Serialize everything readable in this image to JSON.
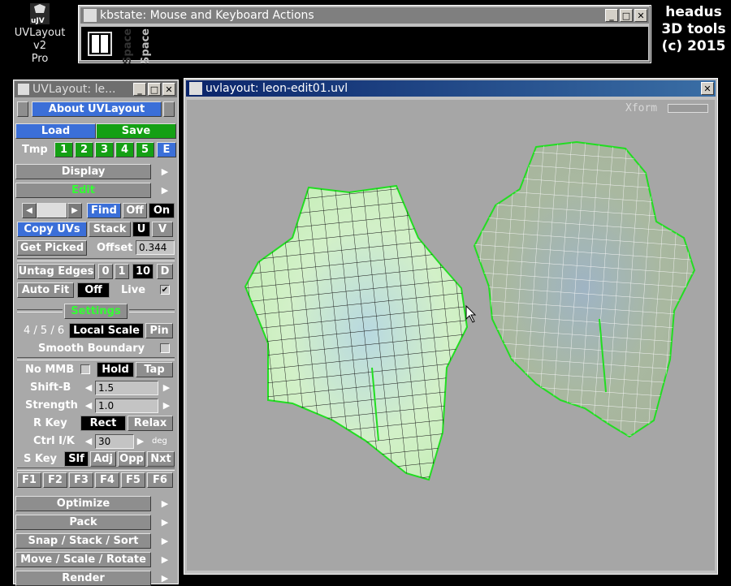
{
  "desktop": {
    "app_icon_caption": "UVLayout v2 Pro",
    "app_icon_line1": "UVLayout v2",
    "app_icon_line2": "Pro",
    "brand_line1": "headus",
    "brand_line2": "3D tools",
    "brand_line3": "(c) 2015"
  },
  "kbstate": {
    "title": "kbstate: Mouse and Keyboard Actions",
    "key_label_1": "Space",
    "key_label_2": "Space"
  },
  "panel": {
    "title": "UVLayout: le...",
    "about": "About UVLayout",
    "load": "Load",
    "save": "Save",
    "tmp_label": "Tmp",
    "tmp_slots": [
      "1",
      "2",
      "3",
      "4",
      "5",
      "E"
    ],
    "display": "Display",
    "edit": "Edit",
    "find": "Find",
    "off": "Off",
    "on": "On",
    "copy_uvs": "Copy UVs",
    "stack": "Stack",
    "u": "U",
    "v": "V",
    "get_picked": "Get Picked",
    "offset_label": "Offset",
    "offset_value": "0.344",
    "untag_edges": "Untag Edges",
    "untag_opts": [
      "0",
      "1",
      "10",
      "D"
    ],
    "auto_fit": "Auto Fit",
    "auto_fit_off": "Off",
    "live": "Live",
    "settings": "Settings",
    "ratio": "4 / 5 / 6",
    "local_scale": "Local Scale",
    "pin": "Pin",
    "smooth_boundary": "Smooth Boundary",
    "no_mmb": "No MMB",
    "hold": "Hold",
    "tap": "Tap",
    "shift_b_label": "Shift-B",
    "shift_b_value": "1.5",
    "strength_label": "Strength",
    "strength_value": "1.0",
    "r_key_label": "R Key",
    "rect": "Rect",
    "relax": "Relax",
    "ctrl_ik_label": "Ctrl I/K",
    "ctrl_ik_value": "30",
    "deg": "deg",
    "s_key_label": "S Key",
    "s_opts": [
      "Slf",
      "Adj",
      "Opp",
      "Nxt"
    ],
    "f_keys": [
      "F1",
      "F2",
      "F3",
      "F4",
      "F5",
      "F6"
    ],
    "optimize": "Optimize",
    "pack": "Pack",
    "snap_stack_sort": "Snap / Stack / Sort",
    "move_scale_rotate": "Move / Scale / Rotate",
    "render": "Render"
  },
  "viewport": {
    "title": "uvlayout: leon-edit01.uvl",
    "xform_label": "Xform"
  },
  "colors": {
    "button_blue": "#3b6fd8",
    "button_green": "#14a014",
    "edit_text_green": "#33ff33",
    "mesh_outline": "#22dd22",
    "canvas_bg": "#a6a6a6"
  }
}
